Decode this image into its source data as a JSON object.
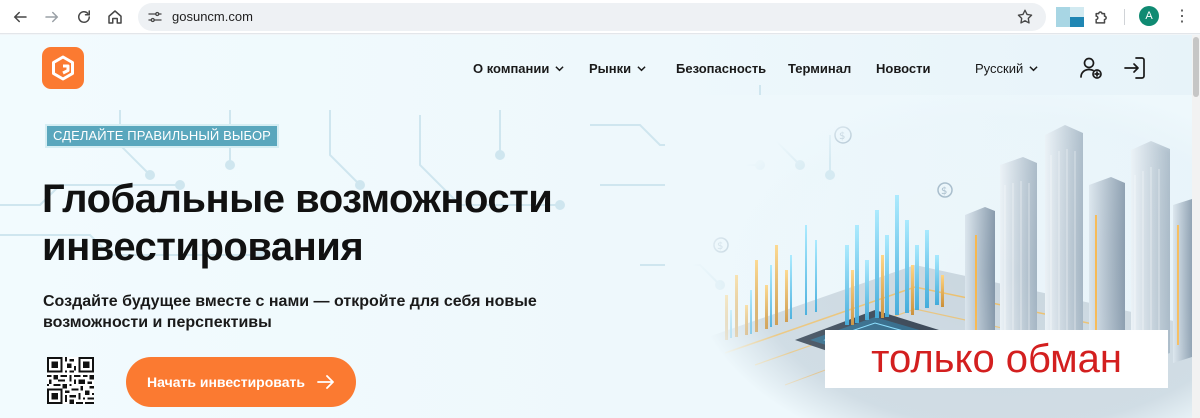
{
  "browser": {
    "url": "gosuncm.com",
    "profile_initial": "A",
    "icons": [
      "back-icon",
      "forward-icon",
      "reload-icon",
      "home-icon",
      "site-settings-icon",
      "star-icon",
      "extensions-puzzle-icon",
      "menu-kebab-icon"
    ]
  },
  "nav": {
    "items": [
      {
        "label": "О компании"
      },
      {
        "label": "Рынки"
      },
      {
        "label": "Безопасность"
      },
      {
        "label": "Терминал"
      },
      {
        "label": "Новости"
      }
    ],
    "language": "Русский"
  },
  "hero": {
    "tagline": "СДЕЛАЙТЕ ПРАВИЛЬНЫЙ ВЫБОР",
    "title_line1": "Глобальные возможности",
    "title_line2": "инвестирования",
    "subtitle_line1": "Создайте будущее вместе с нами — откройте для себя новые",
    "subtitle_line2": "возможности и перспективы",
    "cta_label": "Начать инвестировать"
  },
  "overlay": {
    "watermark_text": "только обман"
  },
  "colors": {
    "accent": "#fb7a31",
    "tagline_bg": "#5aa7bd",
    "watermark_text": "#d31f1f"
  }
}
